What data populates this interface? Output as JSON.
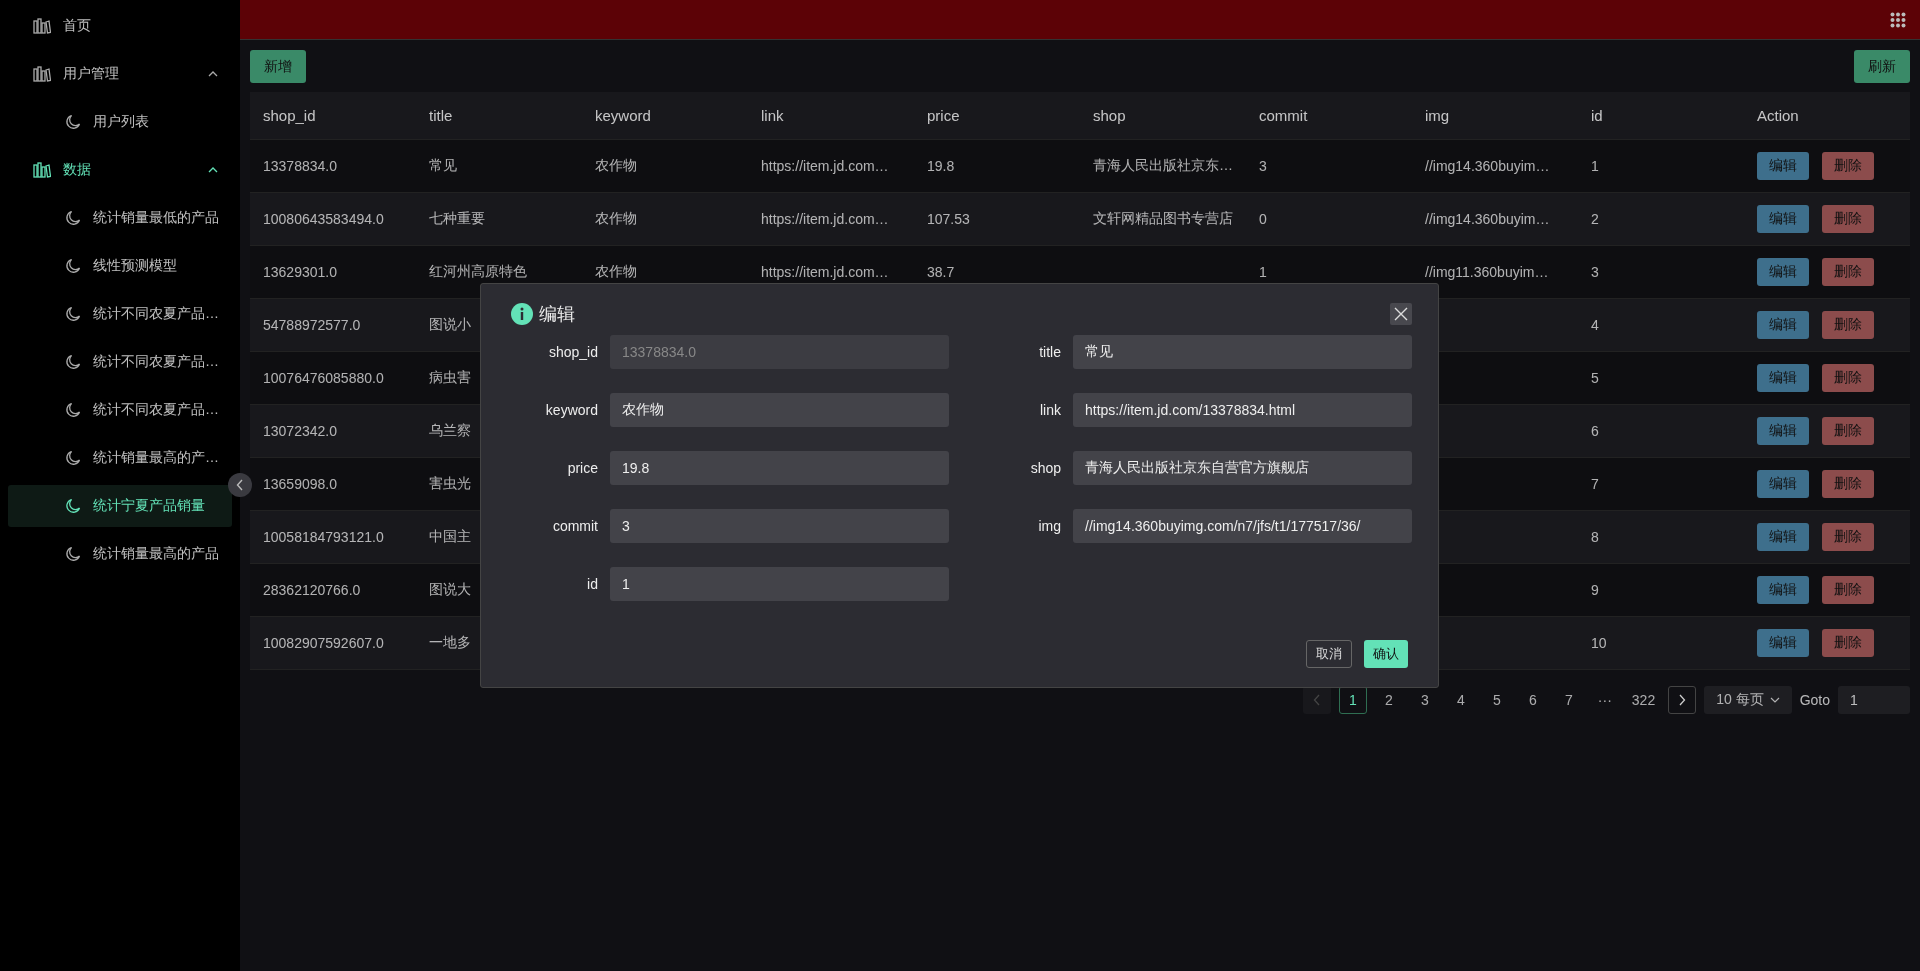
{
  "sidebar": {
    "items": [
      {
        "label": "首页",
        "selected": false
      },
      {
        "label": "用户管理",
        "selected": false,
        "expanded": true,
        "children": [
          {
            "label": "用户列表",
            "selected": false
          }
        ]
      },
      {
        "label": "数据",
        "selected": true,
        "expanded": true,
        "children": [
          {
            "label": "统计销量最低的产品",
            "selected": false
          },
          {
            "label": "线性预测模型",
            "selected": false
          },
          {
            "label": "统计不同农夏产品…",
            "selected": false
          },
          {
            "label": "统计不同农夏产品…",
            "selected": false
          },
          {
            "label": "统计不同农夏产品…",
            "selected": false
          },
          {
            "label": "统计销量最高的产…",
            "selected": false
          },
          {
            "label": "统计宁夏产品销量",
            "selected": true
          },
          {
            "label": "统计销量最高的产品",
            "selected": false
          }
        ]
      }
    ]
  },
  "toolbar": {
    "add_button": "新增",
    "refresh_button": "刷新"
  },
  "table": {
    "columns": [
      "shop_id",
      "title",
      "keyword",
      "link",
      "price",
      "shop",
      "commit",
      "img",
      "id",
      "Action"
    ],
    "rows": [
      {
        "shop_id": "13378834.0",
        "title": "常见",
        "keyword": "农作物",
        "link": "https://item.jd.com…",
        "price": "19.8",
        "shop": "青海人民出版社京东…",
        "commit": "3",
        "img": "//img14.360buyim…",
        "id": "1",
        "actions": [
          "编辑",
          "删除"
        ]
      },
      {
        "shop_id": "10080643583494.0",
        "title": "七种重要",
        "keyword": "农作物",
        "link": "https://item.jd.com…",
        "price": "107.53",
        "shop": "文轩网精品图书专营店",
        "commit": "0",
        "img": "//img14.360buyim…",
        "id": "2",
        "actions": [
          "编辑",
          "删除"
        ]
      },
      {
        "shop_id": "13629301.0",
        "title": "红河州高原特色",
        "keyword": "农作物",
        "link": "https://item.jd.com…",
        "price": "38.7",
        "commit": "1",
        "img": "//img11.360buyim…",
        "id": "3",
        "actions": [
          "编辑",
          "删除"
        ]
      },
      {
        "shop_id": "54788972577.0",
        "title": "图说小",
        "id": "4",
        "actions": [
          "编辑",
          "删除"
        ]
      },
      {
        "shop_id": "10076476085880.0",
        "title": "病虫害",
        "id": "5",
        "actions": [
          "编辑",
          "删除"
        ]
      },
      {
        "shop_id": "13072342.0",
        "title": "乌兰察",
        "id": "6",
        "actions": [
          "编辑",
          "删除"
        ]
      },
      {
        "shop_id": "13659098.0",
        "title": "害虫光",
        "id": "7",
        "actions": [
          "编辑",
          "删除"
        ]
      },
      {
        "shop_id": "10058184793121.0",
        "title": "中国主",
        "id": "8",
        "actions": [
          "编辑",
          "删除"
        ]
      },
      {
        "shop_id": "28362120766.0",
        "title": "图说大",
        "id": "9",
        "actions": [
          "编辑",
          "删除"
        ]
      },
      {
        "shop_id": "10082907592607.0",
        "title": "一地多",
        "id": "10",
        "actions": [
          "编辑",
          "删除"
        ]
      }
    ]
  },
  "pagination": {
    "prev_disabled": true,
    "pages": [
      {
        "label": "1",
        "selected": true
      },
      {
        "label": "2",
        "selected": false
      },
      {
        "label": "3",
        "selected": false
      },
      {
        "label": "4",
        "selected": false
      },
      {
        "label": "5",
        "selected": false
      },
      {
        "label": "6",
        "selected": false
      },
      {
        "label": "7",
        "selected": false
      },
      {
        "label": "···",
        "selected": false
      },
      {
        "label": "322",
        "selected": false
      }
    ],
    "page_size": "10 每页",
    "goto_label": "Goto",
    "goto_value": "1"
  },
  "dialog": {
    "title": "编辑",
    "fields": [
      {
        "label": "shop_id",
        "value": "13378834.0",
        "disabled": true
      },
      {
        "label": "title",
        "value": "常见",
        "disabled": false
      },
      {
        "label": "keyword",
        "value": "农作物",
        "disabled": false
      },
      {
        "label": "link",
        "value": "https://item.jd.com/13378834.html",
        "disabled": false
      },
      {
        "label": "price",
        "value": "19.8",
        "disabled": false
      },
      {
        "label": "shop",
        "value": "青海人民出版社京东自营官方旗舰店",
        "disabled": false
      },
      {
        "label": "commit",
        "value": "3",
        "disabled": false
      },
      {
        "label": "img",
        "value": "//img14.360buyimg.com/n7/jfs/t1/177517/36/",
        "disabled": false
      },
      {
        "label": "id",
        "value": "1",
        "disabled": false
      }
    ],
    "buttons": [
      "取消",
      "确认"
    ]
  }
}
